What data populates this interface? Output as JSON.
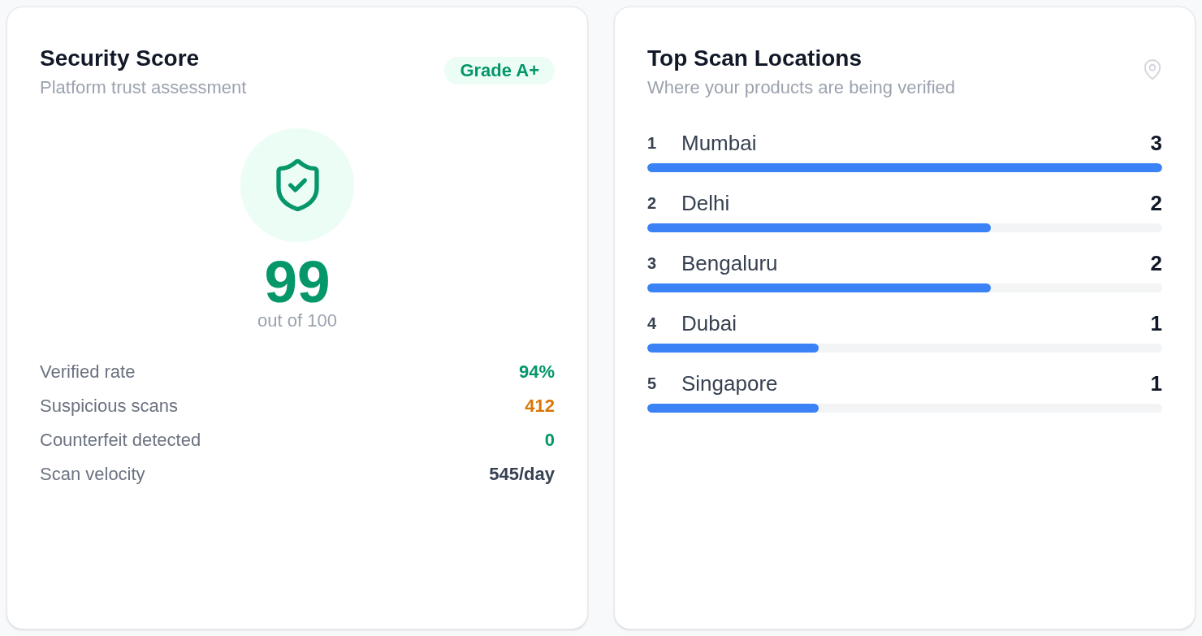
{
  "security_score": {
    "title": "Security Score",
    "subtitle": "Platform trust assessment",
    "badge": "Grade A+",
    "score": "99",
    "score_caption": "out of 100",
    "stats": [
      {
        "label": "Verified rate",
        "value": "94%",
        "color": "#059669"
      },
      {
        "label": "Suspicious scans",
        "value": "412",
        "color": "#d97706"
      },
      {
        "label": "Counterfeit detected",
        "value": "0",
        "color": "#059669"
      },
      {
        "label": "Scan velocity",
        "value": "545/day",
        "color": "#374151"
      }
    ]
  },
  "top_scan_locations": {
    "title": "Top Scan Locations",
    "subtitle": "Where your products are being verified",
    "locations": [
      {
        "rank": "1",
        "name": "Mumbai",
        "count": "3",
        "level": 1
      },
      {
        "rank": "2",
        "name": "Delhi",
        "count": "2",
        "level": 0.667
      },
      {
        "rank": "3",
        "name": "Bengaluru",
        "count": "2",
        "level": 0.667
      },
      {
        "rank": "4",
        "name": "Dubai",
        "count": "1",
        "level": 0.333
      },
      {
        "rank": "5",
        "name": "Singapore",
        "count": "1",
        "level": 0.333
      }
    ]
  }
}
